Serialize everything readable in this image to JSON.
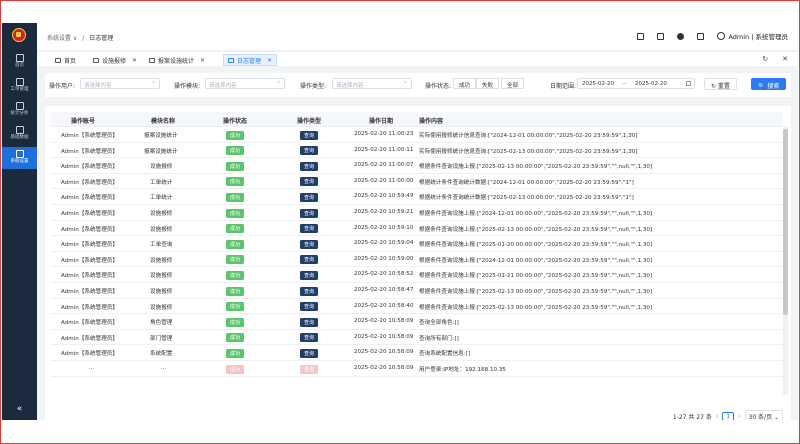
{
  "sidebar": {
    "items": [
      {
        "label": "首页"
      },
      {
        "label": "工单管理"
      },
      {
        "label": "统计分析"
      },
      {
        "label": "基础数据"
      },
      {
        "label": "系统设置"
      }
    ],
    "collapse": "«"
  },
  "header": {
    "crumb_parent": "系统设置 ∨",
    "crumb_sep": "/",
    "crumb_current": "日志管理",
    "user": "Admin | 系统管理员"
  },
  "tabs": [
    {
      "label": "首页",
      "closable": false
    },
    {
      "label": "设施报修",
      "closable": true
    },
    {
      "label": "报案设施统计",
      "closable": true
    },
    {
      "label": "日志管理",
      "closable": true
    }
  ],
  "tab_tools": {
    "refresh": "↻",
    "close_all": "✕"
  },
  "filters": {
    "user_label": "操作用户:",
    "user_placeholder": "请选择内容",
    "module_label": "操作模块:",
    "module_placeholder": "请选择内容",
    "type_label": "操作类型:",
    "type_placeholder": "请选择内容",
    "status_label": "操作状态:",
    "status_options": [
      "成功",
      "失败",
      "全部"
    ],
    "date_label": "日期范围:",
    "date_start": "2025-02-20",
    "date_sep": "—",
    "date_end": "2025-02-20",
    "reset": "↻ 重置",
    "search": "🔍 搜索"
  },
  "table": {
    "columns": [
      "操作账号",
      "模块名称",
      "操作状态",
      "操作类型",
      "操作日期",
      "操作内容"
    ],
    "rows": [
      {
        "account": "Admin【系统管理员】",
        "module": "报案设施统计",
        "status": "成功",
        "type": "查询",
        "date": "2025-02-20 11:00:23",
        "content": "实际使用报修统计信息查询:[\"2024-12-01 00:00:00\",\"2025-02-20 23:59:59\",1,30]"
      },
      {
        "account": "Admin【系统管理员】",
        "module": "报案设施统计",
        "status": "成功",
        "type": "查询",
        "date": "2025-02-20 11:00:11",
        "content": "实际使用报修统计信息查询:[\"2025-02-13 00:00:00\",\"2025-02-20 23:59:59\",1,30]"
      },
      {
        "account": "Admin【系统管理员】",
        "module": "设施报修",
        "status": "成功",
        "type": "查询",
        "date": "2025-02-20 11:00:07",
        "content": "根据条件查询设施上报:[\"2025-02-13 00:00:00\",\"2025-02-20 23:59:59\",\"\",null,\"\",1,30]"
      },
      {
        "account": "Admin【系统管理员】",
        "module": "工单统计",
        "status": "成功",
        "type": "查询",
        "date": "2025-02-20 11:00:00",
        "content": "根据统计条件查询统计数据:[\"2024-12-01 00:00:00\",\"2025-02-20 23:59:59\",\"1\"]"
      },
      {
        "account": "Admin【系统管理员】",
        "module": "工单统计",
        "status": "成功",
        "type": "查询",
        "date": "2025-02-20 10:59:49",
        "content": "根据统计条件查询统计数据:[\"2025-02-13 00:00:00\",\"2025-02-20 23:59:59\",\"1\"]"
      },
      {
        "account": "Admin【系统管理员】",
        "module": "设施报修",
        "status": "成功",
        "type": "查询",
        "date": "2025-02-20 10:59:21",
        "content": "根据条件查询设施上报:[\"2024-12-01 00:00:00\",\"2025-02-20 23:59:59\",\"\",null,\"\",1,30]"
      },
      {
        "account": "Admin【系统管理员】",
        "module": "设施报修",
        "status": "成功",
        "type": "查询",
        "date": "2025-02-20 10:59:10",
        "content": "根据条件查询设施上报:[\"2025-02-13 00:00:00\",\"2025-02-20 23:59:59\",\"\",null,\"\",1,30]"
      },
      {
        "account": "Admin【系统管理员】",
        "module": "工单查询",
        "status": "成功",
        "type": "查询",
        "date": "2025-02-20 10:59:04",
        "content": "根据条件查询设施上报:[\"2025-01-20 00:00:00\",\"2025-02-20 23:59:59\",\"\",null,\"\",1,30]"
      },
      {
        "account": "Admin【系统管理员】",
        "module": "设施报修",
        "status": "成功",
        "type": "查询",
        "date": "2025-02-20 10:59:00",
        "content": "根据条件查询设施上报:[\"2024-12-01 00:00:00\",\"2025-02-20 23:59:59\",\"\",null,\"\",1,30]"
      },
      {
        "account": "Admin【系统管理员】",
        "module": "设施报修",
        "status": "成功",
        "type": "查询",
        "date": "2025-02-20 10:58:52",
        "content": "根据条件查询设施上报:[\"2025-01-21 00:00:00\",\"2025-02-20 23:59:59\",\"\",null,\"\",1,30]"
      },
      {
        "account": "Admin【系统管理员】",
        "module": "设施报修",
        "status": "成功",
        "type": "查询",
        "date": "2025-02-20 10:58:47",
        "content": "根据条件查询设施上报:[\"2025-02-13 00:00:00\",\"2025-02-20 23:59:59\",\"\",null,\"\",1,30]"
      },
      {
        "account": "Admin【系统管理员】",
        "module": "设施报修",
        "status": "成功",
        "type": "查询",
        "date": "2025-02-20 10:58:40",
        "content": "根据条件查询设施上报:[\"2025-02-13 00:00:00\",\"2025-02-20 23:59:59\",\"\",null,\"\",1,30]"
      },
      {
        "account": "Admin【系统管理员】",
        "module": "角色管理",
        "status": "成功",
        "type": "查询",
        "date": "2025-02-20 10:58:09",
        "content": "查询全部角色:[]"
      },
      {
        "account": "Admin【系统管理员】",
        "module": "部门管理",
        "status": "成功",
        "type": "查询",
        "date": "2025-02-20 10:58:09",
        "content": "查询所有部门:[]"
      },
      {
        "account": "Admin【系统管理员】",
        "module": "系统配置",
        "status": "成功",
        "type": "查询",
        "date": "2025-02-20 10:58:09",
        "content": "查询系统配置信息:[]"
      },
      {
        "account": "...",
        "module": "...",
        "status": "成功",
        "type": "查询",
        "date": "2025-02-20 10:58:09",
        "content": "用户登录:IP地址：192.168.10.35",
        "faded": true
      }
    ]
  },
  "pager": {
    "summary": "1-27 共 27 条",
    "prev": "‹",
    "page": "1",
    "next": "›",
    "size": "30 条/页 ⌄"
  }
}
